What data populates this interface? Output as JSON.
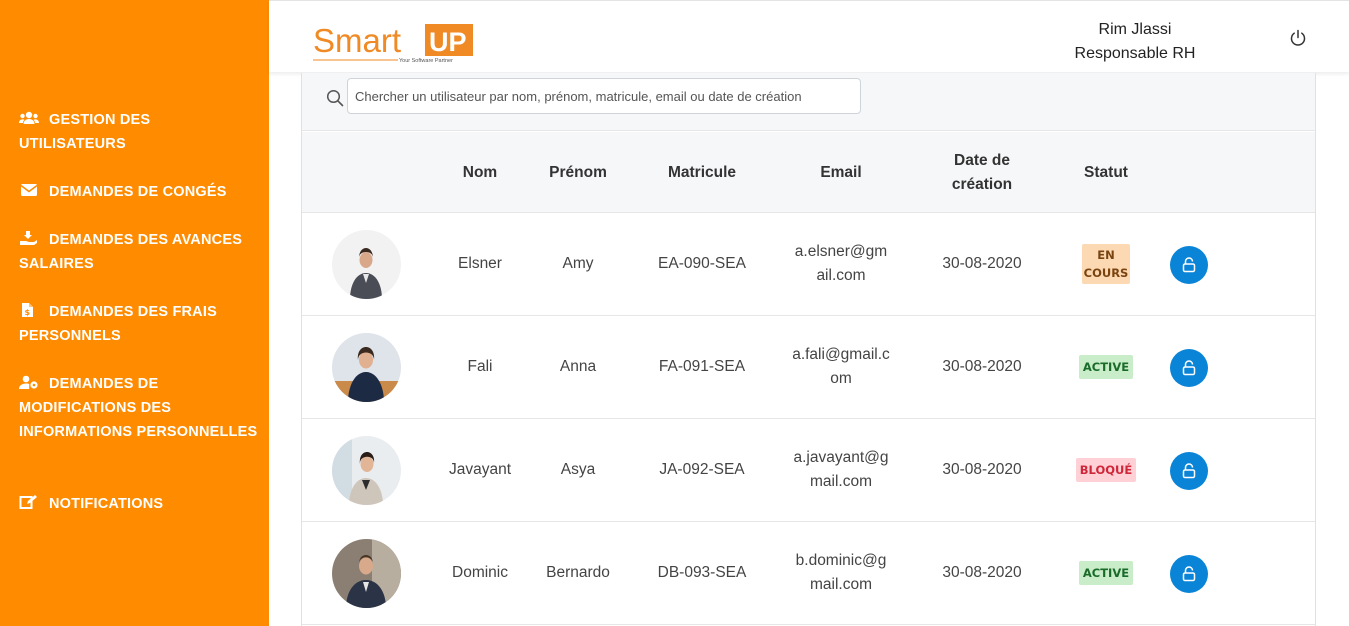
{
  "sidebar": {
    "items": [
      {
        "label": "GESTION DES UTILISATEURS",
        "icon": "users-icon"
      },
      {
        "label": "DEMANDES DE CONGÉS",
        "icon": "envelope-icon"
      },
      {
        "label": "DEMANDES DES AVANCES SALAIRES",
        "icon": "hand-money-icon"
      },
      {
        "label": "DEMANDES DES FRAIS PERSONNELS",
        "icon": "file-invoice-icon"
      },
      {
        "label": "DEMANDES DE MODIFICATIONS DES INFORMATIONS PERSONNELLES",
        "icon": "user-cog-icon"
      },
      {
        "label": "NOTIFICATIONS",
        "icon": "edit-icon"
      }
    ]
  },
  "header": {
    "logo_main": "Smart",
    "logo_accent": "UP",
    "logo_tagline": "Your Software Partner",
    "user_name": "Rim Jlassi",
    "user_role": "Responsable RH"
  },
  "search": {
    "placeholder": "Chercher un utilisateur par nom, prénom, matricule, email ou date de création"
  },
  "table": {
    "headers": {
      "nom": "Nom",
      "prenom": "Prénom",
      "matricule": "Matricule",
      "email": "Email",
      "date": "Date de création",
      "statut": "Statut"
    },
    "rows": [
      {
        "nom": "Elsner",
        "prenom": "Amy",
        "matricule": "EA-090-SEA",
        "email_l1": "a.elsner@gm",
        "email_l2": "ail.com",
        "date": "30-08-2020",
        "statut": "EN COURS",
        "statut_l1": "EN",
        "statut_l2": "COURS"
      },
      {
        "nom": "Fali",
        "prenom": "Anna",
        "matricule": "FA-091-SEA",
        "email_l1": "a.fali@gmail.c",
        "email_l2": "om",
        "date": "30-08-2020",
        "statut": "ACTIVE"
      },
      {
        "nom": "Javayant",
        "prenom": "Asya",
        "matricule": "JA-092-SEA",
        "email_l1": "a.javayant@g",
        "email_l2": "mail.com",
        "date": "30-08-2020",
        "statut": "BLOQUÉ"
      },
      {
        "nom": "Dominic",
        "prenom": "Bernardo",
        "matricule": "DB-093-SEA",
        "email_l1": "b.dominic@g",
        "email_l2": "mail.com",
        "date": "30-08-2020",
        "statut": "ACTIVE"
      }
    ]
  },
  "colors": {
    "sidebar": "#ff8c00",
    "accent_blue": "#0a84d6",
    "badge_encours": "#fdd9b3",
    "badge_active": "#c9ecc9",
    "badge_bloque": "#ffd1d6"
  }
}
